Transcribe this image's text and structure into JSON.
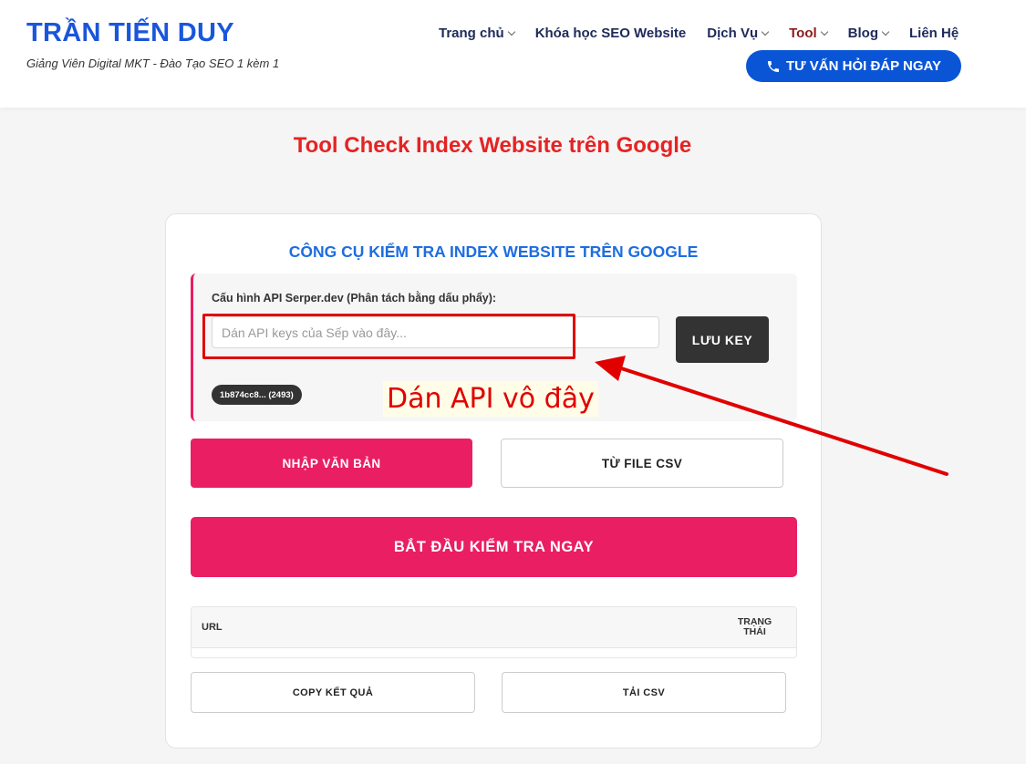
{
  "header": {
    "logo": "TRẦN TIẾN DUY",
    "tagline": "Giảng Viên Digital MKT - Đào Tạo SEO 1 kèm 1",
    "nav": [
      {
        "label": "Trang chủ",
        "dropdown": true
      },
      {
        "label": "Khóa học SEO Website",
        "dropdown": false
      },
      {
        "label": "Dịch Vụ",
        "dropdown": true
      },
      {
        "label": "Tool",
        "dropdown": true,
        "active": true
      },
      {
        "label": "Blog",
        "dropdown": true
      },
      {
        "label": "Liên Hệ",
        "dropdown": false
      }
    ],
    "cta_label": "TƯ VẤN HỎI ĐÁP NGAY",
    "cta_icon": "phone-icon"
  },
  "page_title": "Tool Check Index Website trên Google",
  "tool": {
    "title": "CÔNG CỤ KIỂM TRA INDEX WEBSITE TRÊN GOOGLE",
    "api_label": "Cấu hình API Serper.dev (Phân tách bằng dấu phẩy):",
    "api_placeholder": "Dán API keys của Sếp vào đây...",
    "api_value": "",
    "save_key_label": "LƯU KEY",
    "key_chip": "1b874cc8... (2493)",
    "mode_text_label": "NHẬP VĂN BẢN",
    "mode_csv_label": "TỪ FILE CSV",
    "start_label": "BẮT ĐẦU KIỂM TRA NGAY",
    "table": {
      "col_url": "URL",
      "col_status_line1": "TRẠNG",
      "col_status_line2": "THÁI",
      "rows": []
    },
    "copy_label": "COPY KẾT QUẢ",
    "download_label": "TẢI CSV"
  },
  "annotation": {
    "text": "Dán API vô đây",
    "color": "#e10000"
  },
  "colors": {
    "brand_blue": "#1a56db",
    "cta_blue": "#0a55d6",
    "accent_pink": "#e91e63",
    "title_red": "#e52323",
    "tool_title_blue": "#1e6ddf"
  }
}
